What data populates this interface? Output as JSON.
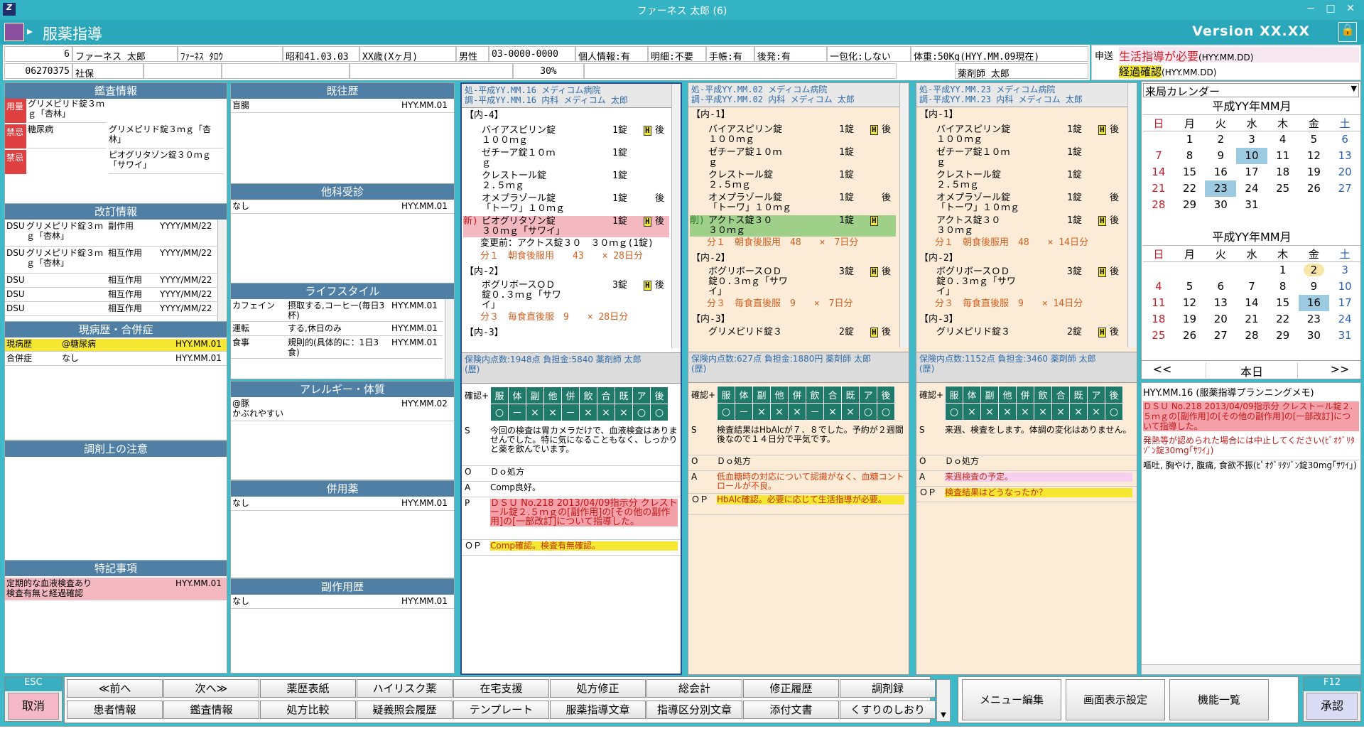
{
  "window": {
    "title": "ファーネス 太郎 (6)",
    "minimize": "−",
    "maximize": "□",
    "close": "✕"
  },
  "app": {
    "name": "服薬指導",
    "version": "Version  XX.XX"
  },
  "patient": {
    "no": "6",
    "name": "ファーネス 太郎",
    "kana": "ﾌｧｰﾈｽ ﾀﾛｳ",
    "birth": "昭和41.03.03",
    "age": "XX歳(Xヶ月)",
    "sex": "男性",
    "phone": "03-0000-0000",
    "privacy": "個人情報:有",
    "detail": "明細:不要",
    "notebook": "手帳:有",
    "generic": "後発:有",
    "onedose": "一包化:しない",
    "weight": "体重:50Kg(HYY.MM.09現在)",
    "code": "06270375",
    "insurance": "社保",
    "ratio": "30%",
    "pharmacist": "薬剤師 太郎",
    "send": "申送"
  },
  "alerts": {
    "a1": "生活指導が必要",
    "a1d": "(HYY.MM.DD)",
    "a2": "経過確認",
    "a2d": "(HYY.MM.DD)"
  },
  "kansa": {
    "title": "鑑査情報",
    "rows": [
      {
        "tag": "用量",
        "c1": "グリメピリド錠３ｍｇ「杏林」",
        "c2": ""
      },
      {
        "tag": "禁忌",
        "c1": "糖尿病",
        "c2": "グリメピリド錠３ｍｇ「杏林」"
      },
      {
        "tag": "禁忌",
        "c1": "",
        "c2": "ピオグリタゾン錠３０ｍｇ「サワイ」"
      }
    ]
  },
  "kaitei": {
    "title": "改訂情報",
    "rows": [
      {
        "src": "DSU",
        "drug": "グリメピリド錠３ｍｇ「杏林」",
        "kind": "副作用",
        "date": "YYYY/MM/22"
      },
      {
        "src": "DSU",
        "drug": "グリメピリド錠３ｍｇ「杏林」",
        "kind": "相互作用",
        "date": "YYYY/MM/22"
      },
      {
        "src": "DSU",
        "drug": "",
        "kind": "相互作用",
        "date": "YYYY/MM/22"
      },
      {
        "src": "DSU",
        "drug": "",
        "kind": "相互作用",
        "date": "YYYY/MM/22"
      },
      {
        "src": "DSU",
        "drug": "",
        "kind": "相互作用",
        "date": "YYYY/MM/22"
      }
    ]
  },
  "genbyo": {
    "title": "現病歴・合併症",
    "rows": [
      {
        "k": "現病歴",
        "v": "@糖尿病",
        "d": "HYY.MM.01"
      },
      {
        "k": "合併症",
        "v": "なし",
        "d": "HYY.MM.01"
      }
    ]
  },
  "chozai": {
    "title": "調剤上の注意"
  },
  "tokki": {
    "title": "特記事項",
    "text": "定期的な血液検査あり\n検査有無と経過確認",
    "date": "HYY.MM.01"
  },
  "kiou": {
    "title": "既往歴",
    "text": "盲腸",
    "date": "HYY.MM.01"
  },
  "taka": {
    "title": "他科受診",
    "text": "なし",
    "date": "HYY.MM.01"
  },
  "life": {
    "title": "ライフスタイル",
    "rows": [
      {
        "k": "カフェイン",
        "v": "摂取する,コーヒー(毎日3杯)",
        "d": "HYY.MM.01"
      },
      {
        "k": "運転",
        "v": "する,休日のみ",
        "d": "HYY.MM.01"
      },
      {
        "k": "食事",
        "v": "規則的(具体的に：1日3食)",
        "d": "HYY.MM.01"
      }
    ]
  },
  "allergy": {
    "title": "アレルギー・体質",
    "text": "@豚\nかぶれやすい",
    "date": "HYY.MM.02"
  },
  "heiyou": {
    "title": "併用薬",
    "text": "なし",
    "date": "HYY.MM.01"
  },
  "fukusayou": {
    "title": "副作用歴",
    "text": "なし",
    "date": "HYY.MM.01"
  },
  "rx1": {
    "h1": "処-平成YY.MM.16 メディコム病院",
    "h2": "調-平成YY.MM.16 内科 メディコム  太郎",
    "g1": "【内-4】",
    "drugs": [
      {
        "n": "バイアスピリン錠\n１００ｍｇ",
        "q": "1錠",
        "h": "H",
        "t": "後"
      },
      {
        "n": "ゼチーア錠１０ｍ\nｇ",
        "q": "1錠",
        "h": "",
        "t": ""
      },
      {
        "n": "クレストール錠\n２.５ｍｇ",
        "q": "1錠",
        "h": "",
        "t": ""
      },
      {
        "n": "オメプラゾール錠\n「トーワ」１０ｍｇ",
        "q": "1錠",
        "h": "",
        "t": "後"
      },
      {
        "n": "ピオグリタゾン錠\n３０ｍｇ「サワイ」",
        "q": "1錠",
        "h": "H",
        "t": "後"
      }
    ],
    "newtag": "新)",
    "change": "変更前：アクトス錠３０　３０ｍｇ(1錠)",
    "dose1": "分１　朝食後服用　　43　　× 28日分",
    "g2": "【内-2】",
    "d2": {
      "n": "ボグリボースＯＤ\n錠０.３ｍｇ「サワ\nイ」",
      "q": "3錠",
      "h": "H",
      "t": "後"
    },
    "dose2": "分３　毎食直後服　9　　× 28日分",
    "g3": "【内-3】",
    "foot": "保険内点数:1948点 負担金:5840 薬剤師 太郎\n(歴)",
    "soap": {
      "S": "今回の検査は胃カメラだけで、血液検査はありませんでした。特に気になることもなく、しっかりと薬を飲んでいます。",
      "O": "Ｄｏ処方",
      "A": "Comp良好。",
      "P": "ＤＳＵ No.218 2013/04/09指示分 クレストール錠２.５ｍｇの[副作用]の[その他の副作用]の[一部改訂]について指導した。",
      "OP": "Comp確認。検査有無確認。"
    },
    "marks": [
      "○",
      "－",
      "×",
      "×",
      "－",
      "×",
      "×",
      "×",
      "○",
      "○"
    ]
  },
  "rx2": {
    "h1": "処-平成YY.MM.02 メディコム病院",
    "h2": "調-平成YY.MM.02 内科 メディコム  太郎",
    "g1": "【内-1】",
    "drugs": [
      {
        "n": "バイアスピリン錠\n１００ｍｇ",
        "q": "1錠",
        "h": "H",
        "t": "後"
      },
      {
        "n": "ゼチーア錠１０ｍ\nｇ",
        "q": "1錠",
        "h": "",
        "t": ""
      },
      {
        "n": "クレストール錠\n２.５ｍｇ",
        "q": "1錠",
        "h": "",
        "t": ""
      },
      {
        "n": "オメプラゾール錠\n「トーワ」１０ｍｇ",
        "q": "1錠",
        "h": "",
        "t": "後"
      },
      {
        "n": "アクトス錠３０\n３０ｍｇ",
        "q": "1錠",
        "h": "H",
        "t": ""
      }
    ],
    "deltag": "削)",
    "dose1": "分１　朝食後服用　48　　×　7日分",
    "g2": "【内-2】",
    "d2": {
      "n": "ボグリボースＯＤ\n錠０.３ｍｇ「サワ\nイ」",
      "q": "3錠",
      "h": "H",
      "t": "後"
    },
    "dose2": "分３　毎食直後服　9　　×　7日分",
    "g3": "【内-3】",
    "d3": {
      "n": "グリメピリド錠３",
      "q": "2錠",
      "h": "H",
      "t": "後"
    },
    "foot": "保険内点数:627点 負担金:1880円 薬剤師 太郎\n(歴)",
    "soap": {
      "S": "検査結果はHbAlcが７．８でした。予約が２週間後なので１４日分で平気です。",
      "O": "Ｄｏ処方",
      "A": "低血糖時の対応について認識がなく、血糖コントロールが不良。",
      "OP": "HbAlc確認。必要に応じて生活指導が必要。"
    },
    "marks": [
      "○",
      "－",
      "×",
      "×",
      "×",
      "－",
      "×",
      "×",
      "○",
      "○"
    ]
  },
  "rx3": {
    "h1": "処-平成YY.MM.23 メディコム病院",
    "h2": "調-平成YY.MM.23 内科 メディコム  太郎",
    "g1": "【内-1】",
    "drugs": [
      {
        "n": "バイアスピリン錠\n１００ｍｇ",
        "q": "1錠",
        "h": "H",
        "t": "後"
      },
      {
        "n": "ゼチーア錠１０ｍ\nｇ",
        "q": "1錠",
        "h": "",
        "t": ""
      },
      {
        "n": "クレストール錠\n２.５ｍｇ",
        "q": "1錠",
        "h": "",
        "t": ""
      },
      {
        "n": "オメプラゾール錠\n「トーワ」１０ｍｇ",
        "q": "1錠",
        "h": "",
        "t": "後"
      },
      {
        "n": "アクトス錠３０\n３０ｍｇ",
        "q": "1錠",
        "h": "H",
        "t": "後"
      }
    ],
    "dose1": "分１　朝食後服用　48　　× 14日分",
    "g2": "【内-2】",
    "d2": {
      "n": "ボグリボースＯＤ\n錠０.３ｍｇ「サワ\nイ」",
      "q": "3錠",
      "h": "H",
      "t": "後"
    },
    "dose2": "分３　毎食直後服　9　　× 14日分",
    "g3": "【内-3】",
    "d3": {
      "n": "グリメピリド錠３",
      "q": "2錠",
      "h": "H",
      "t": "後"
    },
    "foot": "保険内点数:1152点 負担金:3460 薬剤師 太郎\n(歴)",
    "soap": {
      "S": "来週、検査をします。体調の変化はありません。",
      "O": "Ｄｏ処方",
      "A": "来週検査の予定。",
      "OP": "検査結果はどうなったか？"
    },
    "marks": [
      "○",
      "×",
      "×",
      "×",
      "×",
      "×",
      "×",
      "×",
      "×",
      "○"
    ]
  },
  "gridhead": [
    "確認+",
    "服",
    "体",
    "副",
    "他",
    "併",
    "飲",
    "合",
    "既",
    "ア",
    "後"
  ],
  "calendar": {
    "select": "来局カレンダー",
    "m1": "平成YY年MM月",
    "m2": "平成YY年MM月",
    "days": [
      "日",
      "月",
      "火",
      "水",
      "木",
      "金",
      "土"
    ],
    "w1": [
      [
        "",
        "1",
        "2",
        "3",
        "4",
        "5",
        "6"
      ],
      [
        "7",
        "8",
        "9",
        "10",
        "11",
        "12",
        "13"
      ],
      [
        "14",
        "15",
        "16",
        "17",
        "18",
        "19",
        "20"
      ],
      [
        "21",
        "22",
        "23",
        "24",
        "25",
        "26",
        "27"
      ],
      [
        "28",
        "29",
        "30",
        "31",
        "",
        "",
        ""
      ]
    ],
    "w2": [
      [
        "",
        "",
        "",
        "",
        "1",
        "2",
        "3"
      ],
      [
        "4",
        "5",
        "6",
        "7",
        "8",
        "9",
        "10"
      ],
      [
        "11",
        "12",
        "13",
        "14",
        "15",
        "16",
        "17"
      ],
      [
        "18",
        "19",
        "20",
        "21",
        "22",
        "23",
        "24"
      ],
      [
        "25",
        "26",
        "27",
        "28",
        "29",
        "30",
        "31"
      ]
    ],
    "prev": "<<",
    "today": "本日",
    "next": ">>"
  },
  "memo": {
    "title": "HYY.MM.16 (服薬指導プランニングメモ)",
    "m1": "ＤＳＵ No.218 2013/04/09指示分 クレストール錠２.５ｍｇの[副作用]の[その他の副作用]の[一部改訂]について指導した。",
    "m2": "発熱等が認められた場合には中止してください(ﾋﾟｵｸﾞﾘﾀｿﾞﾝ錠30mg｢ｻﾜｲ｣)",
    "m3": "嘔吐, 胸やけ, 腹痛, 食欲不振(ﾋﾟｵｸﾞﾘﾀｿﾞﾝ錠30mg｢ｻﾜｲ｣)"
  },
  "footer": {
    "esc": "ESC",
    "cancel": "取消",
    "row1": [
      "≪前へ",
      "次へ≫",
      "薬歴表紙",
      "ハイリスク薬",
      "在宅支援",
      "処方修正",
      "総会計",
      "修正履歴",
      "調剤録"
    ],
    "row2": [
      "患者情報",
      "鑑査情報",
      "処方比較",
      "疑義照会履歴",
      "テンプレート",
      "服薬指導文章",
      "指導区分別文章",
      "添付文書",
      "くすりのしおり"
    ],
    "menu": "メニュー編集",
    "display": "画面表示設定",
    "func": "機能一覧",
    "f12": "F12",
    "approve": "承認"
  },
  "colors": {
    "accent": "#2aa7ba",
    "panelHeader": "#4f7fa4",
    "rxBg": "#fcecd7",
    "grid": "#1f7a6a",
    "alert": "#d0202a",
    "highlight": "#f2e830",
    "pink": "#f4b8c0"
  }
}
